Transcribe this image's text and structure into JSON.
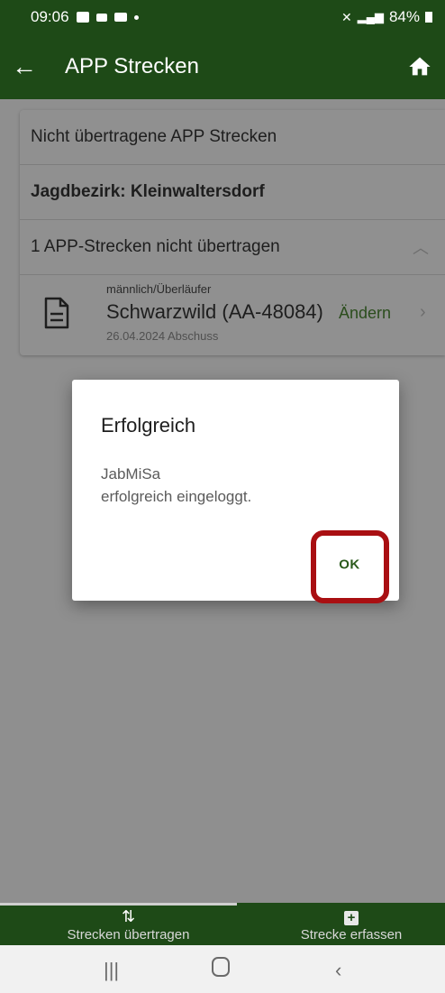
{
  "status": {
    "time": "09:06",
    "battery": "84%"
  },
  "appbar": {
    "title": "APP Strecken"
  },
  "list": {
    "header": "Nicht übertragene APP Strecken",
    "district": "Jagdbezirk: Kleinwaltersdorf",
    "group_label": "1 APP-Strecken nicht übertragen",
    "item": {
      "subtitle": "männlich/Überläufer",
      "name": "Schwarzwild (AA-48084)",
      "date": "26.04.2024 Abschuss",
      "edit_label": "Ändern"
    }
  },
  "dialog": {
    "title": "Erfolgreich",
    "line1": "JabMiSa",
    "line2": "erfolgreich eingeloggt.",
    "ok_label": "OK"
  },
  "bottomnav": {
    "left_label": "Strecken übertragen",
    "right_label": "Strecke erfassen"
  },
  "colors": {
    "brand": "#1e4a17",
    "highlight": "#a90f12"
  }
}
